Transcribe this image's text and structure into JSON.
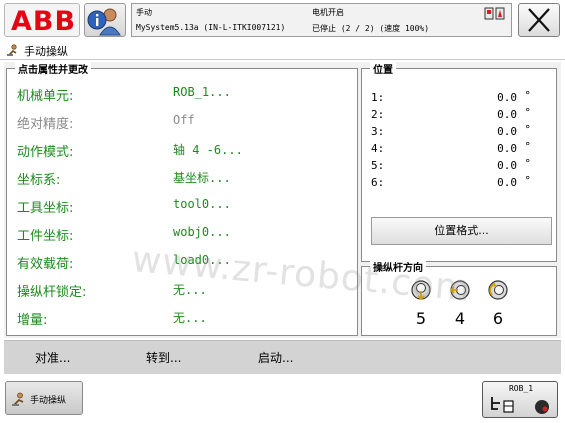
{
  "header": {
    "logo_text": "ABB",
    "status": {
      "mode": "手动",
      "system": "MySystem5.13a (IN-L-ITKI007121)",
      "motors": "电机开启",
      "state": "已停止 (2 / 2) (速度 100%)"
    }
  },
  "window": {
    "title": "手动操纵"
  },
  "properties": {
    "title": "点击属性并更改",
    "rows": [
      {
        "label": "机械单元:",
        "value": "ROB_1...",
        "enabled": true
      },
      {
        "label": "绝对精度:",
        "value": "Off",
        "enabled": false
      },
      {
        "label": "动作模式:",
        "value": "轴 4 -6...",
        "enabled": true
      },
      {
        "label": "坐标系:",
        "value": "基坐标...",
        "enabled": true
      },
      {
        "label": "工具坐标:",
        "value": "tool0...",
        "enabled": true
      },
      {
        "label": "工件坐标:",
        "value": "wobj0...",
        "enabled": true
      },
      {
        "label": "有效载荷:",
        "value": "load0...",
        "enabled": true
      },
      {
        "label": "操纵杆锁定:",
        "value": "无...",
        "enabled": true
      },
      {
        "label": "增量:",
        "value": "无...",
        "enabled": true
      }
    ]
  },
  "position": {
    "title": "位置",
    "rows": [
      {
        "axis": "1:",
        "value": "0.0",
        "unit": "°"
      },
      {
        "axis": "2:",
        "value": "0.0",
        "unit": "°"
      },
      {
        "axis": "3:",
        "value": "0.0",
        "unit": "°"
      },
      {
        "axis": "4:",
        "value": "0.0",
        "unit": "°"
      },
      {
        "axis": "5:",
        "value": "0.0",
        "unit": "°"
      },
      {
        "axis": "6:",
        "value": "0.0",
        "unit": "°"
      }
    ],
    "format_button": "位置格式..."
  },
  "joystick": {
    "title": "操纵杆方向",
    "axes": [
      "5",
      "4",
      "6"
    ]
  },
  "commands": {
    "align": "对准...",
    "goto": "转到...",
    "start": "启动..."
  },
  "taskbar": {
    "jog_task": "手动操纵",
    "mech_unit": "ROB_1",
    "speed_hint": "1/3"
  },
  "watermark": "www.zr-robot.com",
  "colors": {
    "enabled_text": "#1d8a1d",
    "disabled_text": "#8a8a8a",
    "abb_red": "#e30613",
    "command_bar": "#d3d3d3"
  }
}
